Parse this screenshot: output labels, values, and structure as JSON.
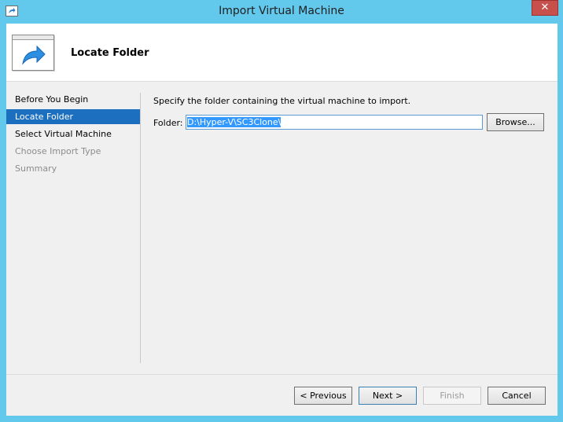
{
  "window": {
    "title": "Import Virtual Machine",
    "close_glyph": "✕"
  },
  "header": {
    "title": "Locate Folder",
    "icon": "import-arrow-icon"
  },
  "nav": {
    "items": [
      {
        "label": "Before You Begin",
        "state": "normal"
      },
      {
        "label": "Locate Folder",
        "state": "active"
      },
      {
        "label": "Select Virtual Machine",
        "state": "normal"
      },
      {
        "label": "Choose Import Type",
        "state": "disabled"
      },
      {
        "label": "Summary",
        "state": "disabled"
      }
    ]
  },
  "main": {
    "prompt": "Specify the folder containing the virtual machine to import.",
    "folder_label": "Folder:",
    "folder_value": "D:\\Hyper-V\\SC3Clone\\",
    "browse_label": "Browse..."
  },
  "footer": {
    "previous_label": "< Previous",
    "next_label": "Next >",
    "finish_label": "Finish",
    "cancel_label": "Cancel"
  },
  "colors": {
    "frame": "#62c9ec",
    "nav_active": "#1c6fbe",
    "selection": "#3399ff",
    "close_button": "#c7504c"
  }
}
